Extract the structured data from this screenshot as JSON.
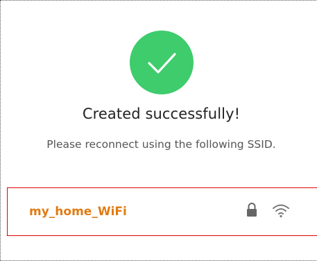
{
  "dialog": {
    "title": "Created successfully!",
    "message": "Please reconnect using the following SSID."
  },
  "network": {
    "ssid": "my_home_WiFi",
    "secured": true,
    "icons": [
      "lock-icon",
      "wifi-icon"
    ]
  },
  "colors": {
    "success": "#3ecc6c",
    "ssid_text": "#e07b12",
    "highlight_border": "#e00000"
  }
}
